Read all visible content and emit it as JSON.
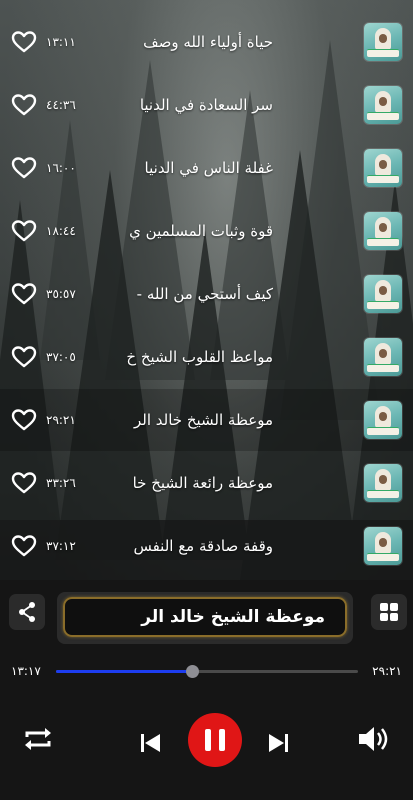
{
  "tracks": [
    {
      "title": "حياة أولياء الله وصف",
      "duration": "١٣:١١"
    },
    {
      "title": "سر السعادة في الدنيا",
      "duration": "٤٤:٣٦"
    },
    {
      "title": "غفلة الناس في الدنيا",
      "duration": "١٦:٠٠"
    },
    {
      "title": "قوة وثبات المسلمين ي",
      "duration": "١٨:٤٤"
    },
    {
      "title": "كيف أستحي من الله -",
      "duration": "٣٥:٥٧"
    },
    {
      "title": "مواعظ القلوب الشيخ خ",
      "duration": "٣٧:٠٥"
    },
    {
      "title": "موعظة الشيخ خالد الر",
      "duration": "٢٩:٢١"
    },
    {
      "title": "موعظة رائعة الشيخ خا",
      "duration": "٣٣:٢٦"
    },
    {
      "title": "وقفة صادقة مع النفس",
      "duration": "٣٧:١٢"
    }
  ],
  "active_track_index": 6,
  "player": {
    "now_playing": "موعظة الشيخ خالد الر",
    "elapsed": "١٣:١٧",
    "total": "٢٩:٢١",
    "progress_fraction": 0.45,
    "icons": {
      "share": "share-icon",
      "grid": "grid-icon",
      "repeat": "repeat-icon",
      "previous": "skip-previous-icon",
      "pause": "pause-icon",
      "next": "skip-next-icon",
      "volume": "volume-icon",
      "favorite": "heart-outline-icon"
    }
  },
  "colors": {
    "accent_red": "#e01616",
    "seek_blue": "#1d3df0",
    "pill_border": "#8a6d2a"
  }
}
